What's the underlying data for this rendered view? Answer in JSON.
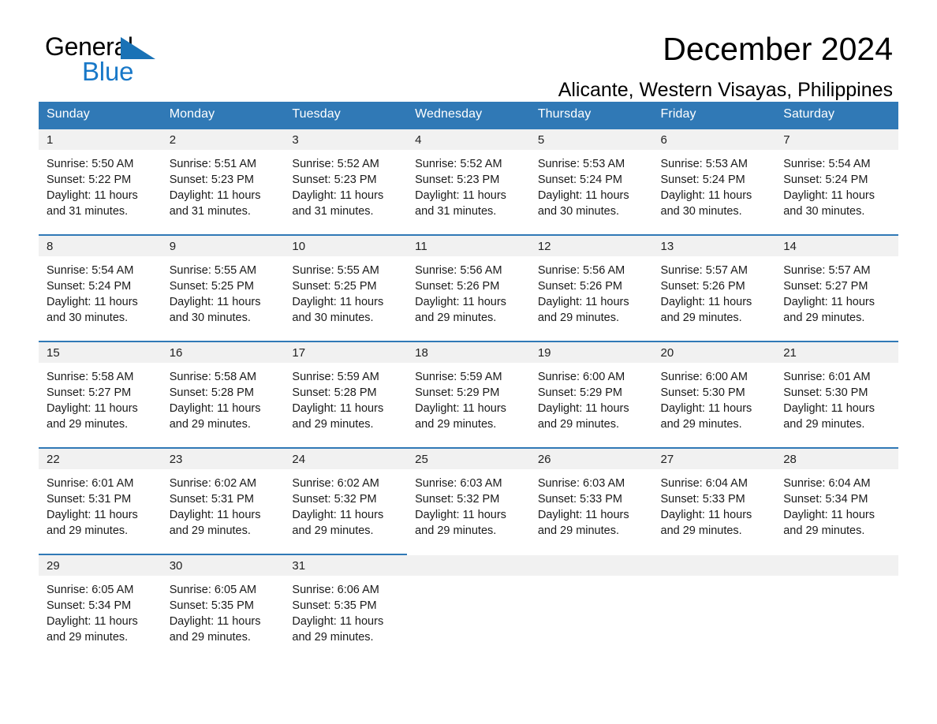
{
  "brand": {
    "name_top": "General",
    "name_bottom": "Blue",
    "accent_color": "#1878c8",
    "triangle_color": "#1972b6"
  },
  "header": {
    "title": "December 2024",
    "subtitle": "Alicante, Western Visayas, Philippines"
  },
  "calendar": {
    "header_bg": "#3079b6",
    "daynum_bg": "#f1f1f1",
    "weekday_headers": [
      "Sunday",
      "Monday",
      "Tuesday",
      "Wednesday",
      "Thursday",
      "Friday",
      "Saturday"
    ],
    "labels": {
      "sunrise_prefix": "Sunrise:",
      "sunset_prefix": "Sunset:",
      "daylight_prefix": "Daylight:"
    },
    "weeks": [
      [
        {
          "day": "1",
          "sunrise": "Sunrise: 5:50 AM",
          "sunset": "Sunset: 5:22 PM",
          "daylight_l1": "Daylight: 11 hours",
          "daylight_l2": "and 31 minutes."
        },
        {
          "day": "2",
          "sunrise": "Sunrise: 5:51 AM",
          "sunset": "Sunset: 5:23 PM",
          "daylight_l1": "Daylight: 11 hours",
          "daylight_l2": "and 31 minutes."
        },
        {
          "day": "3",
          "sunrise": "Sunrise: 5:52 AM",
          "sunset": "Sunset: 5:23 PM",
          "daylight_l1": "Daylight: 11 hours",
          "daylight_l2": "and 31 minutes."
        },
        {
          "day": "4",
          "sunrise": "Sunrise: 5:52 AM",
          "sunset": "Sunset: 5:23 PM",
          "daylight_l1": "Daylight: 11 hours",
          "daylight_l2": "and 31 minutes."
        },
        {
          "day": "5",
          "sunrise": "Sunrise: 5:53 AM",
          "sunset": "Sunset: 5:24 PM",
          "daylight_l1": "Daylight: 11 hours",
          "daylight_l2": "and 30 minutes."
        },
        {
          "day": "6",
          "sunrise": "Sunrise: 5:53 AM",
          "sunset": "Sunset: 5:24 PM",
          "daylight_l1": "Daylight: 11 hours",
          "daylight_l2": "and 30 minutes."
        },
        {
          "day": "7",
          "sunrise": "Sunrise: 5:54 AM",
          "sunset": "Sunset: 5:24 PM",
          "daylight_l1": "Daylight: 11 hours",
          "daylight_l2": "and 30 minutes."
        }
      ],
      [
        {
          "day": "8",
          "sunrise": "Sunrise: 5:54 AM",
          "sunset": "Sunset: 5:24 PM",
          "daylight_l1": "Daylight: 11 hours",
          "daylight_l2": "and 30 minutes."
        },
        {
          "day": "9",
          "sunrise": "Sunrise: 5:55 AM",
          "sunset": "Sunset: 5:25 PM",
          "daylight_l1": "Daylight: 11 hours",
          "daylight_l2": "and 30 minutes."
        },
        {
          "day": "10",
          "sunrise": "Sunrise: 5:55 AM",
          "sunset": "Sunset: 5:25 PM",
          "daylight_l1": "Daylight: 11 hours",
          "daylight_l2": "and 30 minutes."
        },
        {
          "day": "11",
          "sunrise": "Sunrise: 5:56 AM",
          "sunset": "Sunset: 5:26 PM",
          "daylight_l1": "Daylight: 11 hours",
          "daylight_l2": "and 29 minutes."
        },
        {
          "day": "12",
          "sunrise": "Sunrise: 5:56 AM",
          "sunset": "Sunset: 5:26 PM",
          "daylight_l1": "Daylight: 11 hours",
          "daylight_l2": "and 29 minutes."
        },
        {
          "day": "13",
          "sunrise": "Sunrise: 5:57 AM",
          "sunset": "Sunset: 5:26 PM",
          "daylight_l1": "Daylight: 11 hours",
          "daylight_l2": "and 29 minutes."
        },
        {
          "day": "14",
          "sunrise": "Sunrise: 5:57 AM",
          "sunset": "Sunset: 5:27 PM",
          "daylight_l1": "Daylight: 11 hours",
          "daylight_l2": "and 29 minutes."
        }
      ],
      [
        {
          "day": "15",
          "sunrise": "Sunrise: 5:58 AM",
          "sunset": "Sunset: 5:27 PM",
          "daylight_l1": "Daylight: 11 hours",
          "daylight_l2": "and 29 minutes."
        },
        {
          "day": "16",
          "sunrise": "Sunrise: 5:58 AM",
          "sunset": "Sunset: 5:28 PM",
          "daylight_l1": "Daylight: 11 hours",
          "daylight_l2": "and 29 minutes."
        },
        {
          "day": "17",
          "sunrise": "Sunrise: 5:59 AM",
          "sunset": "Sunset: 5:28 PM",
          "daylight_l1": "Daylight: 11 hours",
          "daylight_l2": "and 29 minutes."
        },
        {
          "day": "18",
          "sunrise": "Sunrise: 5:59 AM",
          "sunset": "Sunset: 5:29 PM",
          "daylight_l1": "Daylight: 11 hours",
          "daylight_l2": "and 29 minutes."
        },
        {
          "day": "19",
          "sunrise": "Sunrise: 6:00 AM",
          "sunset": "Sunset: 5:29 PM",
          "daylight_l1": "Daylight: 11 hours",
          "daylight_l2": "and 29 minutes."
        },
        {
          "day": "20",
          "sunrise": "Sunrise: 6:00 AM",
          "sunset": "Sunset: 5:30 PM",
          "daylight_l1": "Daylight: 11 hours",
          "daylight_l2": "and 29 minutes."
        },
        {
          "day": "21",
          "sunrise": "Sunrise: 6:01 AM",
          "sunset": "Sunset: 5:30 PM",
          "daylight_l1": "Daylight: 11 hours",
          "daylight_l2": "and 29 minutes."
        }
      ],
      [
        {
          "day": "22",
          "sunrise": "Sunrise: 6:01 AM",
          "sunset": "Sunset: 5:31 PM",
          "daylight_l1": "Daylight: 11 hours",
          "daylight_l2": "and 29 minutes."
        },
        {
          "day": "23",
          "sunrise": "Sunrise: 6:02 AM",
          "sunset": "Sunset: 5:31 PM",
          "daylight_l1": "Daylight: 11 hours",
          "daylight_l2": "and 29 minutes."
        },
        {
          "day": "24",
          "sunrise": "Sunrise: 6:02 AM",
          "sunset": "Sunset: 5:32 PM",
          "daylight_l1": "Daylight: 11 hours",
          "daylight_l2": "and 29 minutes."
        },
        {
          "day": "25",
          "sunrise": "Sunrise: 6:03 AM",
          "sunset": "Sunset: 5:32 PM",
          "daylight_l1": "Daylight: 11 hours",
          "daylight_l2": "and 29 minutes."
        },
        {
          "day": "26",
          "sunrise": "Sunrise: 6:03 AM",
          "sunset": "Sunset: 5:33 PM",
          "daylight_l1": "Daylight: 11 hours",
          "daylight_l2": "and 29 minutes."
        },
        {
          "day": "27",
          "sunrise": "Sunrise: 6:04 AM",
          "sunset": "Sunset: 5:33 PM",
          "daylight_l1": "Daylight: 11 hours",
          "daylight_l2": "and 29 minutes."
        },
        {
          "day": "28",
          "sunrise": "Sunrise: 6:04 AM",
          "sunset": "Sunset: 5:34 PM",
          "daylight_l1": "Daylight: 11 hours",
          "daylight_l2": "and 29 minutes."
        }
      ],
      [
        {
          "day": "29",
          "sunrise": "Sunrise: 6:05 AM",
          "sunset": "Sunset: 5:34 PM",
          "daylight_l1": "Daylight: 11 hours",
          "daylight_l2": "and 29 minutes."
        },
        {
          "day": "30",
          "sunrise": "Sunrise: 6:05 AM",
          "sunset": "Sunset: 5:35 PM",
          "daylight_l1": "Daylight: 11 hours",
          "daylight_l2": "and 29 minutes."
        },
        {
          "day": "31",
          "sunrise": "Sunrise: 6:06 AM",
          "sunset": "Sunset: 5:35 PM",
          "daylight_l1": "Daylight: 11 hours",
          "daylight_l2": "and 29 minutes."
        },
        {
          "day": "",
          "sunrise": "",
          "sunset": "",
          "daylight_l1": "",
          "daylight_l2": ""
        },
        {
          "day": "",
          "sunrise": "",
          "sunset": "",
          "daylight_l1": "",
          "daylight_l2": ""
        },
        {
          "day": "",
          "sunrise": "",
          "sunset": "",
          "daylight_l1": "",
          "daylight_l2": ""
        },
        {
          "day": "",
          "sunrise": "",
          "sunset": "",
          "daylight_l1": "",
          "daylight_l2": ""
        }
      ]
    ]
  }
}
